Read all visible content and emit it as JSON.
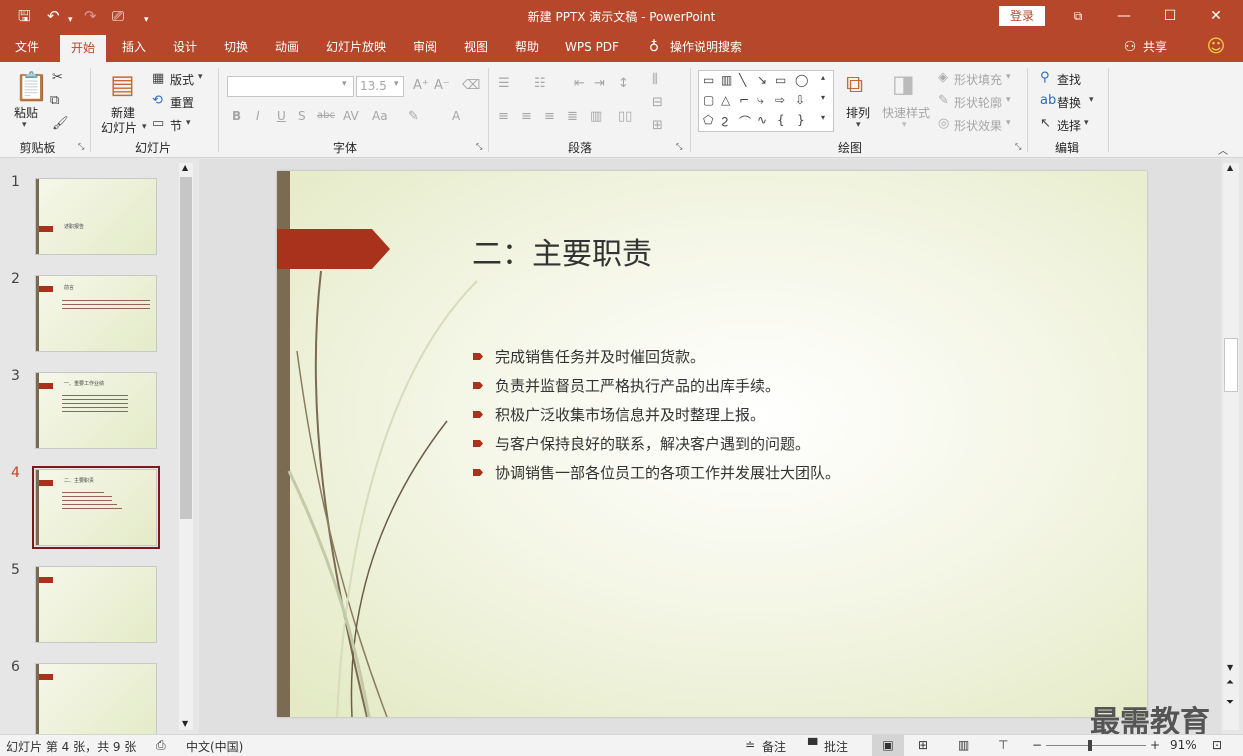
{
  "window": {
    "title": "新建 PPTX 演示文稿 - PowerPoint",
    "login": "登录",
    "quick_access": {
      "save": "save-icon",
      "undo": "undo-icon",
      "redo": "redo-icon",
      "present": "present-icon",
      "more": "more-icon"
    },
    "controls": {
      "restore_ribbon": "ribbon-display-icon",
      "minimize": "—",
      "maximize": "☐",
      "close": "✕"
    }
  },
  "menu": {
    "tabs": [
      "文件",
      "开始",
      "插入",
      "设计",
      "切换",
      "动画",
      "幻灯片放映",
      "审阅",
      "视图",
      "帮助",
      "WPS PDF"
    ],
    "active_tab": "开始",
    "tell_me": "操作说明搜索",
    "share": "共享",
    "emoji": "☺"
  },
  "ribbon": {
    "clipboard": {
      "label": "剪贴板",
      "paste": "粘贴"
    },
    "slides": {
      "label": "幻灯片",
      "new_slide_line1": "新建",
      "new_slide_line2": "幻灯片",
      "layout": "版式",
      "reset": "重置",
      "section": "节"
    },
    "font": {
      "label": "字体",
      "font_name": "",
      "font_size": "13.5",
      "bold": "B",
      "italic": "I",
      "underline": "U",
      "shadow": "S",
      "strike": "abc",
      "spacing": "AV",
      "case": "Aa",
      "color": "A"
    },
    "paragraph": {
      "label": "段落"
    },
    "drawing": {
      "label": "绘图",
      "arrange": "排列",
      "quick_styles": "快速样式",
      "shape_fill": "形状填充",
      "shape_outline": "形状轮廓",
      "shape_effects": "形状效果"
    },
    "editing": {
      "label": "编辑",
      "find": "查找",
      "replace": "替换",
      "select": "选择"
    }
  },
  "thumbnails": [
    {
      "num": "1",
      "title": "述职报告"
    },
    {
      "num": "2",
      "title": "前言"
    },
    {
      "num": "3",
      "title": "一、重要工作业绩"
    },
    {
      "num": "4",
      "title": "二、主要职责"
    },
    {
      "num": "5",
      "title": ""
    },
    {
      "num": "6",
      "title": ""
    }
  ],
  "selected_slide": "4",
  "slide": {
    "title": "二：主要职责",
    "bullets": [
      "完成销售任务并及时催回货款。",
      "负责并监督员工严格执行产品的出库手续。",
      "积极广泛收集市场信息并及时整理上报。",
      "与客户保持良好的联系，解决客户遇到的问题。",
      "协调销售一部各位员工的各项工作并发展壮大团队。"
    ],
    "accent_color": "#a8321c"
  },
  "status": {
    "slide_info": "幻灯片 第 4 张，共 9 张",
    "language": "中文(中国)",
    "notes": "备注",
    "comments": "批注",
    "zoom": "91%",
    "zoom_minus": "−",
    "zoom_plus": "+"
  },
  "watermark": "最需教育",
  "colors": {
    "titlebar": "#b7472a",
    "ribbon": "#f3f3f3"
  }
}
